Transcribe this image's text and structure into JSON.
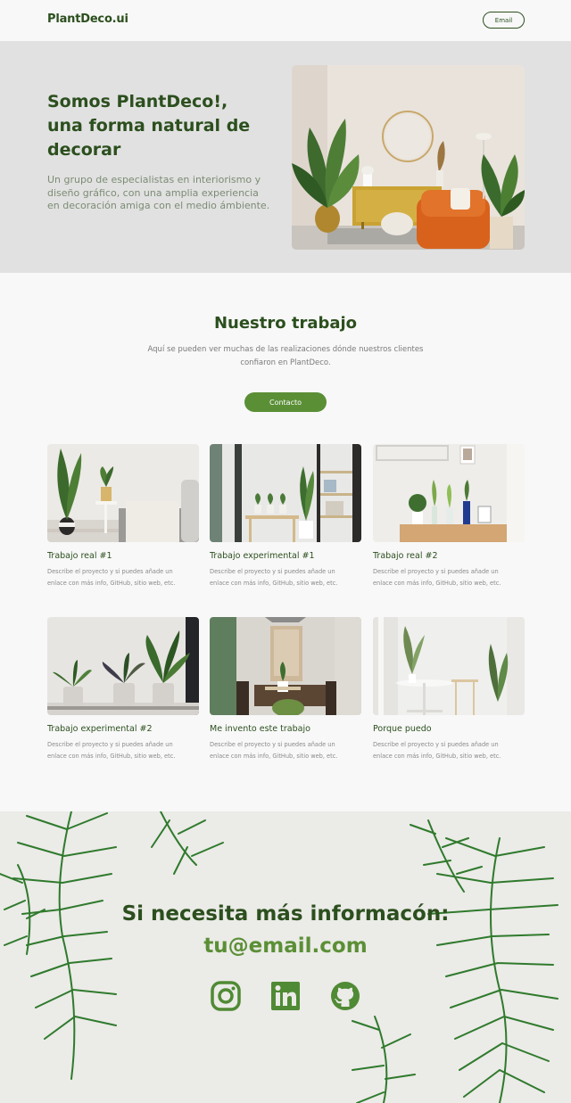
{
  "header": {
    "brand": "PlantDeco.ui",
    "email_button": "Email"
  },
  "hero": {
    "title_line1": "Somos PlantDeco!,",
    "title_line2": "una forma natural de",
    "title_line3": "decorar",
    "description": "Un grupo de especialistas en interiorismo y diseño gráfico, con una amplia experiencia en decoración amiga con el medio ámbiente."
  },
  "work": {
    "title": "Nuestro trabajo",
    "description": "Aquí se pueden ver muchas de las realizaciones dónde nuestros clientes confiaron en PlantDeco.",
    "contact_button": "Contacto",
    "projects": [
      {
        "title": "Trabajo real #1",
        "description": "Describe el proyecto y si puedes añade un enlace con más info, GitHub, sitio web, etc."
      },
      {
        "title": "Trabajo experimental #1",
        "description": "Describe el proyecto y si puedes añade un enlace con más info, GitHub, sitio web, etc."
      },
      {
        "title": "Trabajo real #2",
        "description": "Describe el proyecto y si puedes añade un enlace con más info, GitHub, sitio web, etc."
      },
      {
        "title": "Trabajo experimental #2",
        "description": "Describe el proyecto y si puedes añade un enlace con más info, GitHub, sitio web, etc."
      },
      {
        "title": "Me invento este trabajo",
        "description": "Describe el proyecto y si puedes añade un enlace con más info, GitHub, sitio web, etc."
      },
      {
        "title": "Porque puedo",
        "description": "Describe el proyecto y si puedes añade un enlace con más info, GitHub, sitio web, etc."
      }
    ]
  },
  "footer": {
    "title": "Si necesita más informacón:",
    "email": "tu@email.com",
    "social_icons": [
      "instagram-icon",
      "linkedin-icon",
      "github-icon"
    ]
  },
  "colors": {
    "primary_dark": "#2c4f1e",
    "accent_green": "#5b8f36",
    "hero_bg": "#e1e1e1",
    "page_bg": "#f8f8f8"
  }
}
